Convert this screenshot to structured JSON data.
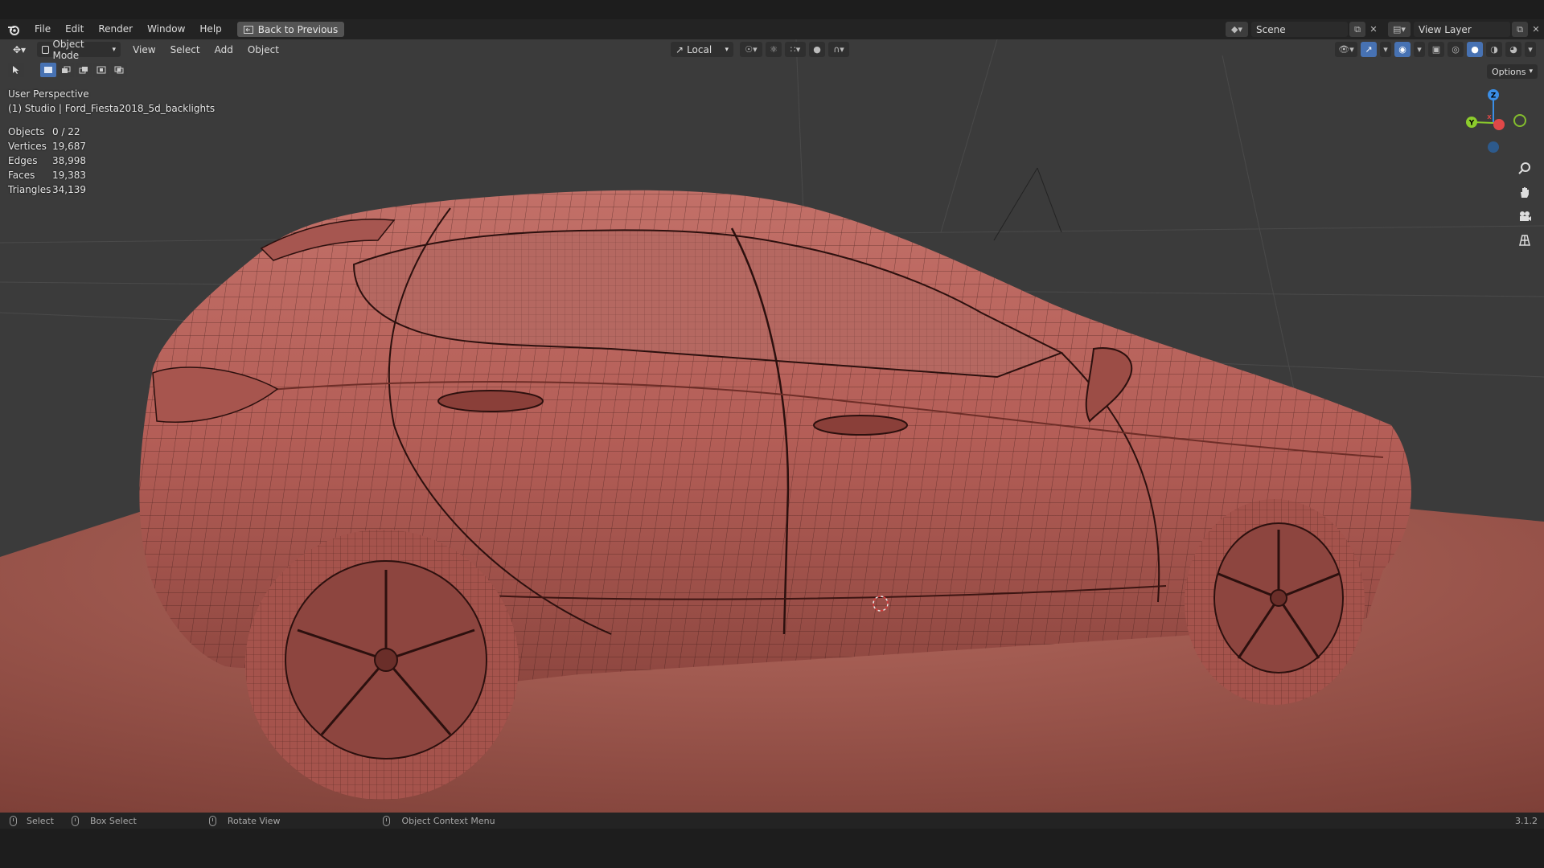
{
  "topbar": {
    "menus": [
      "File",
      "Edit",
      "Render",
      "Window",
      "Help"
    ],
    "back_button": "Back to Previous",
    "scene_name": "Scene",
    "view_layer_name": "View Layer"
  },
  "header": {
    "mode": "Object Mode",
    "menus": [
      "View",
      "Select",
      "Add",
      "Object"
    ],
    "transform_orientation": "Local",
    "options_label": "Options"
  },
  "viewport": {
    "perspective": "User Perspective",
    "active_object": "(1) Studio | Ford_Fiesta2018_5d_backlights",
    "stats": [
      {
        "label": "Objects",
        "value": "0 / 22"
      },
      {
        "label": "Vertices",
        "value": "19,687"
      },
      {
        "label": "Edges",
        "value": "38,998"
      },
      {
        "label": "Faces",
        "value": "19,383"
      },
      {
        "label": "Triangles",
        "value": "34,139"
      }
    ],
    "gizmo_axes": {
      "z": "Z",
      "y": "Y",
      "x": "X"
    }
  },
  "statusbar": {
    "select": "Select",
    "box_select": "Box Select",
    "rotate_view": "Rotate View",
    "context_menu": "Object Context Menu",
    "version": "3.1.2"
  },
  "colors": {
    "accent": "#4772b3",
    "model": "#b05c56",
    "floor": "#9a5048",
    "background": "#3b3b3b",
    "axis_x": "#e04848",
    "axis_y": "#8ccc2c",
    "axis_z": "#3a8ee6"
  }
}
